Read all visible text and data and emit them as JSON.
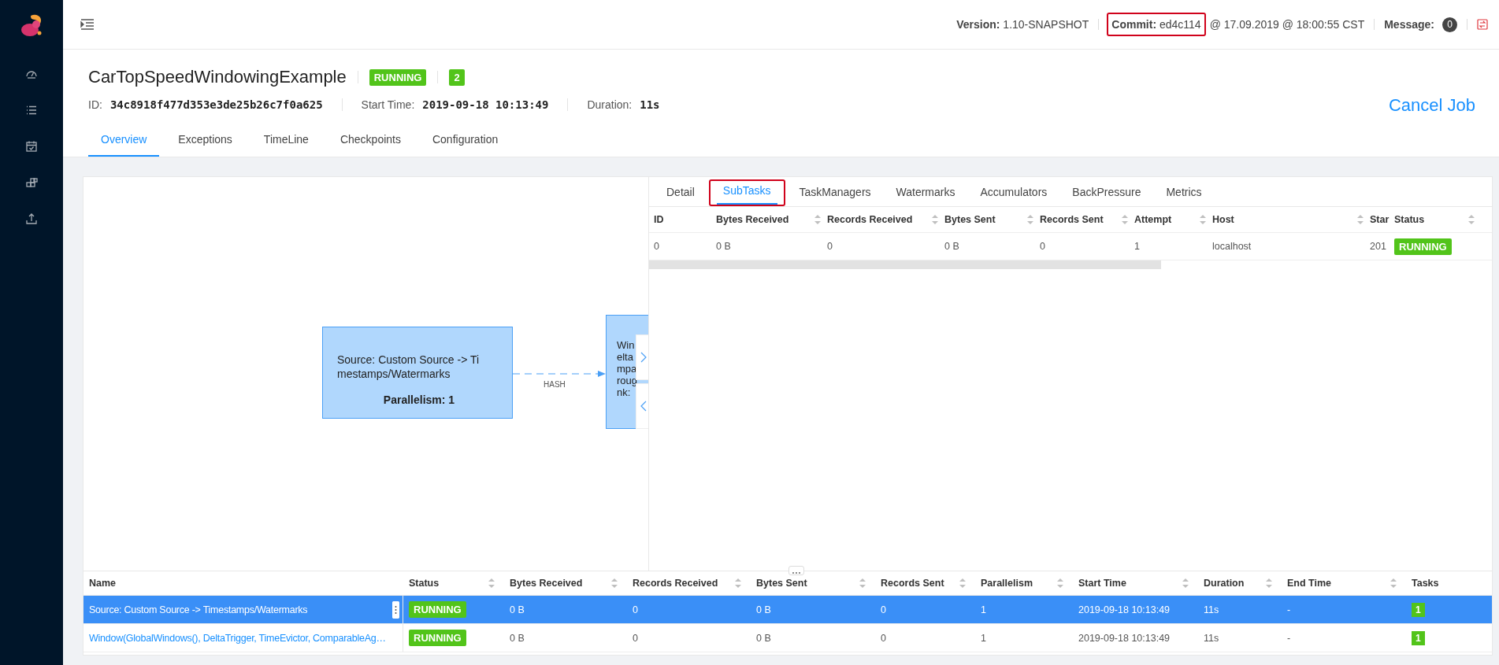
{
  "header": {
    "version": "**Version:** 1.10-SNAPSHOT",
    "commit": {
      "text": "**Commit:** ed4c114",
      "highlighted": true
    },
    "commit_date": "@ 17.09.2019 @ 18:00:55 CST",
    "message_label": "Message:",
    "message_count": "0"
  },
  "job": {
    "title": "CarTopSpeedWindowingExample",
    "status": "RUNNING",
    "parallelism": "2",
    "id_label": "ID:",
    "id": "34c8918f477d353e3de25b26c7f0a625",
    "start_label": "Start Time:",
    "start": "2019-09-18 10:13:49",
    "duration_label": "Duration:",
    "duration": "11s",
    "cancel": "Cancel Job"
  },
  "tabs": [
    {
      "label": "Overview",
      "selected": true
    },
    {
      "label": "Exceptions",
      "selected": false
    },
    {
      "label": "TimeLine",
      "selected": false
    },
    {
      "label": "Checkpoints",
      "selected": false
    },
    {
      "label": "Configuration",
      "selected": false
    }
  ],
  "graph": {
    "nodes": [
      {
        "lines": [
          "Source: Custom Source -> Ti",
          "mestamps/Watermarks"
        ],
        "parallelism": "Parallelism: 1"
      },
      {
        "lines": [
          "Win",
          "elta",
          "mpa",
          "roug",
          "nk:"
        ]
      }
    ],
    "edge_label": "HASH"
  },
  "detail_tabs": [
    {
      "label": "Detail",
      "selected": false,
      "highlighted": false
    },
    {
      "label": "SubTasks",
      "selected": true,
      "highlighted": true
    },
    {
      "label": "TaskManagers",
      "selected": false,
      "highlighted": false
    },
    {
      "label": "Watermarks",
      "selected": false,
      "highlighted": false
    },
    {
      "label": "Accumulators",
      "selected": false,
      "highlighted": false
    },
    {
      "label": "BackPressure",
      "selected": false,
      "highlighted": false
    },
    {
      "label": "Metrics",
      "selected": false,
      "highlighted": false
    }
  ],
  "subtasks": {
    "columns": [
      {
        "label": "ID",
        "sortable": false
      },
      {
        "label": "Bytes Received",
        "sortable": true
      },
      {
        "label": "Records Received",
        "sortable": true
      },
      {
        "label": "Bytes Sent",
        "sortable": true
      },
      {
        "label": "Records Sent",
        "sortable": true
      },
      {
        "label": "Attempt",
        "sortable": true
      },
      {
        "label": "Host",
        "sortable": true
      },
      {
        "label": "Star"
      },
      {
        "label": "Status",
        "sortable": true
      }
    ],
    "rows": [
      {
        "cells": [
          "0",
          "0 B",
          "0",
          "0 B",
          "0",
          "1",
          "localhost",
          "201",
          "RUNNING"
        ]
      }
    ]
  },
  "vertices": {
    "columns": [
      {
        "label": "Name",
        "sortable": false
      },
      {
        "label": "Status",
        "sortable": true
      },
      {
        "label": "Bytes Received",
        "sortable": true
      },
      {
        "label": "Records Received",
        "sortable": true
      },
      {
        "label": "Bytes Sent",
        "sortable": true
      },
      {
        "label": "Records Sent",
        "sortable": true
      },
      {
        "label": "Parallelism",
        "sortable": true
      },
      {
        "label": "Start Time",
        "sortable": true
      },
      {
        "label": "Duration",
        "sortable": true
      },
      {
        "label": "End Time",
        "sortable": true
      },
      {
        "label": "Tasks",
        "sortable": false
      }
    ],
    "rows": [
      {
        "selected": true,
        "cells": [
          "Source: Custom Source -> Timestamps/Watermarks",
          "RUNNING",
          "0 B",
          "0",
          "0 B",
          "0",
          "1",
          "2019-09-18 10:13:49",
          "11s",
          "-",
          "1"
        ]
      },
      {
        "selected": false,
        "cells": [
          "Window(GlobalWindows(), DeltaTrigger, TimeEvictor, ComparableAg…",
          "RUNNING",
          "0 B",
          "0",
          "0 B",
          "0",
          "1",
          "2019-09-18 10:13:49",
          "11s",
          "-",
          "1"
        ]
      }
    ]
  }
}
